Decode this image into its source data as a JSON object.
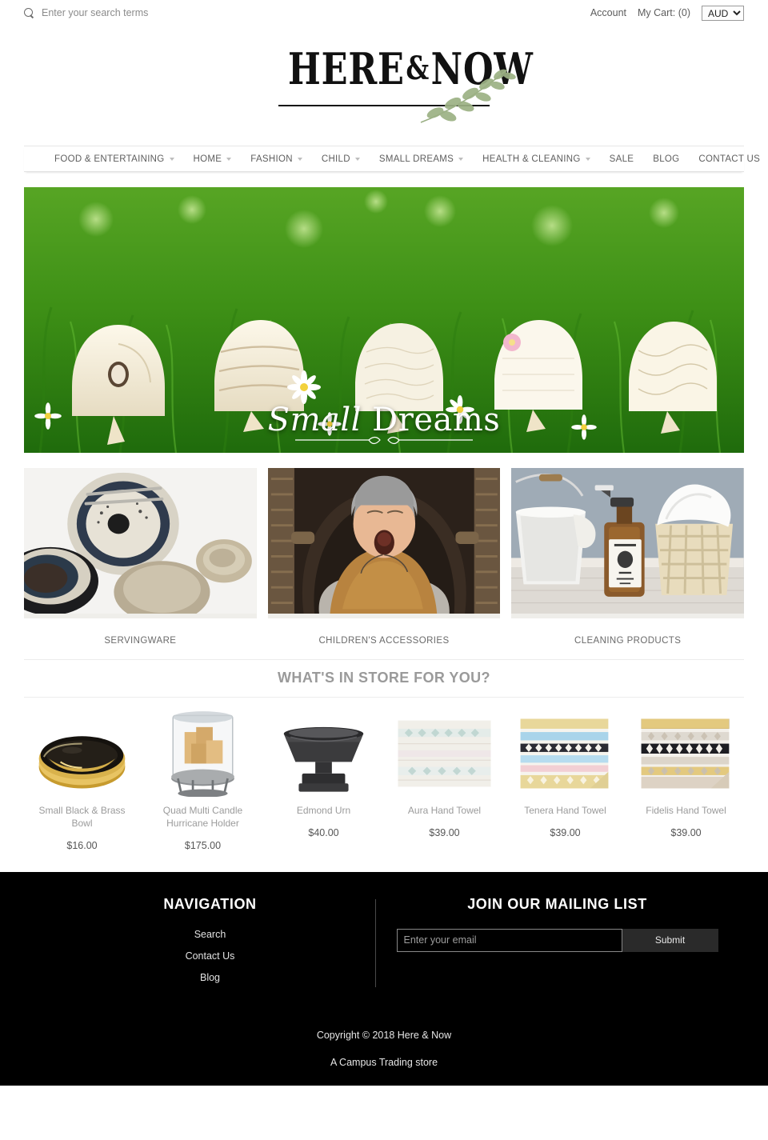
{
  "topbar": {
    "search_placeholder": "Enter your search terms",
    "account_label": "Account",
    "cart_label": "My Cart: (0)",
    "currency_selected": "AUD",
    "currency_options": [
      "AUD"
    ]
  },
  "logo": {
    "word1": "HERE",
    "amp": "&",
    "word2": "NOW"
  },
  "nav": {
    "items": [
      {
        "label": "FOOD & ENTERTAINING",
        "has_dropdown": true
      },
      {
        "label": "HOME",
        "has_dropdown": true
      },
      {
        "label": "FASHION",
        "has_dropdown": true
      },
      {
        "label": "CHILD",
        "has_dropdown": true
      },
      {
        "label": "SMALL DREAMS",
        "has_dropdown": true
      },
      {
        "label": "HEALTH & CLEANING",
        "has_dropdown": true
      },
      {
        "label": "SALE",
        "has_dropdown": false
      },
      {
        "label": "BLOG",
        "has_dropdown": false
      },
      {
        "label": "CONTACT US",
        "has_dropdown": false
      }
    ]
  },
  "hero": {
    "caption_small": "Small",
    "caption_dreams": "Dreams",
    "alt": "Row of five cream baby bonnets displayed on stands in sunlit green grass with white daisies"
  },
  "categories": [
    {
      "label": "SERVINGWARE",
      "alt": "Stoneware plates and bowls in navy and beige on white surface"
    },
    {
      "label": "CHILDREN'S ACCESSORIES",
      "alt": "Yawning newborn swaddled in tan wrap wearing grey bonnet in woven bassinet"
    },
    {
      "label": "CLEANING PRODUCTS",
      "alt": "White metal bucket, amber glass spray bottle and wicker basket of white linens"
    }
  ],
  "section": {
    "heading": "WHAT'S IN STORE FOR YOU?"
  },
  "products": [
    {
      "title": "Small Black & Brass Bowl",
      "price": "$16.00"
    },
    {
      "title": "Quad Multi Candle Hurricane Holder",
      "price": "$175.00"
    },
    {
      "title": "Edmond Urn",
      "price": "$40.00"
    },
    {
      "title": "Aura Hand Towel",
      "price": "$39.00"
    },
    {
      "title": "Tenera Hand Towel",
      "price": "$39.00"
    },
    {
      "title": "Fidelis Hand Towel",
      "price": "$39.00"
    }
  ],
  "footer": {
    "nav_heading": "NAVIGATION",
    "nav_links": [
      "Search",
      "Contact Us",
      "Blog"
    ],
    "mail_heading": "JOIN OUR MAILING LIST",
    "mail_placeholder": "Enter your email",
    "mail_submit": "Submit",
    "copyright": "Copyright © 2018 Here & Now",
    "attribution": "A Campus Trading store"
  },
  "colors": {
    "footer_bg": "#000000",
    "nav_text": "#5e5e5e",
    "heading_grey": "#9a9a9a",
    "hero_green": "#3f8f17"
  }
}
